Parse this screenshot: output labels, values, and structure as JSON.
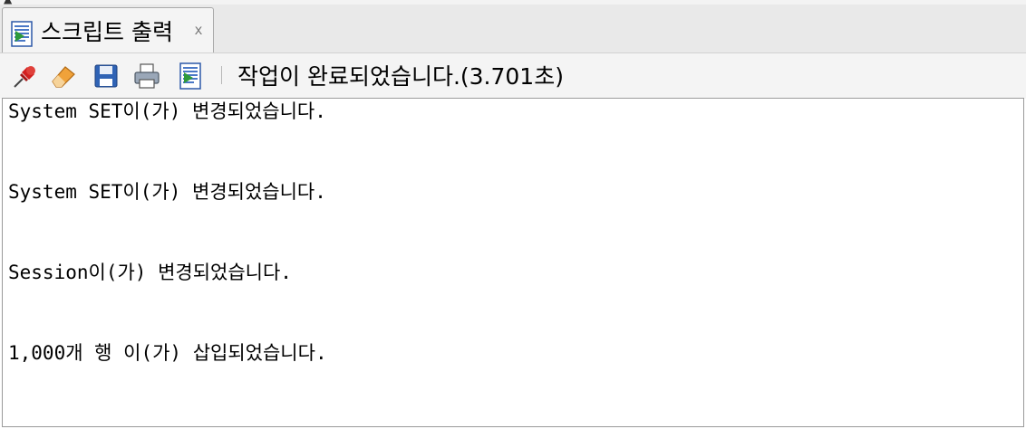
{
  "tab": {
    "title": "스크립트 출력",
    "close_glyph": "x",
    "icon": "script-document-icon"
  },
  "toolbar": {
    "buttons": [
      {
        "name": "pin-icon"
      },
      {
        "name": "eraser-icon"
      },
      {
        "name": "save-icon"
      },
      {
        "name": "print-icon"
      },
      {
        "name": "script-document-icon"
      }
    ],
    "status": "작업이 완료되었습니다.(3.701초)"
  },
  "output": {
    "lines": [
      "System SET이(가) 변경되었습니다.",
      "System SET이(가) 변경되었습니다.",
      "Session이(가) 변경되었습니다.",
      "1,000개 행 이(가) 삽입되었습니다."
    ]
  },
  "colors": {
    "pin": "#d21f1f",
    "eraser": "#f0a23a",
    "save": "#2f63b5",
    "doc_green": "#2e9a3a",
    "doc_blue": "#4a78c6"
  }
}
